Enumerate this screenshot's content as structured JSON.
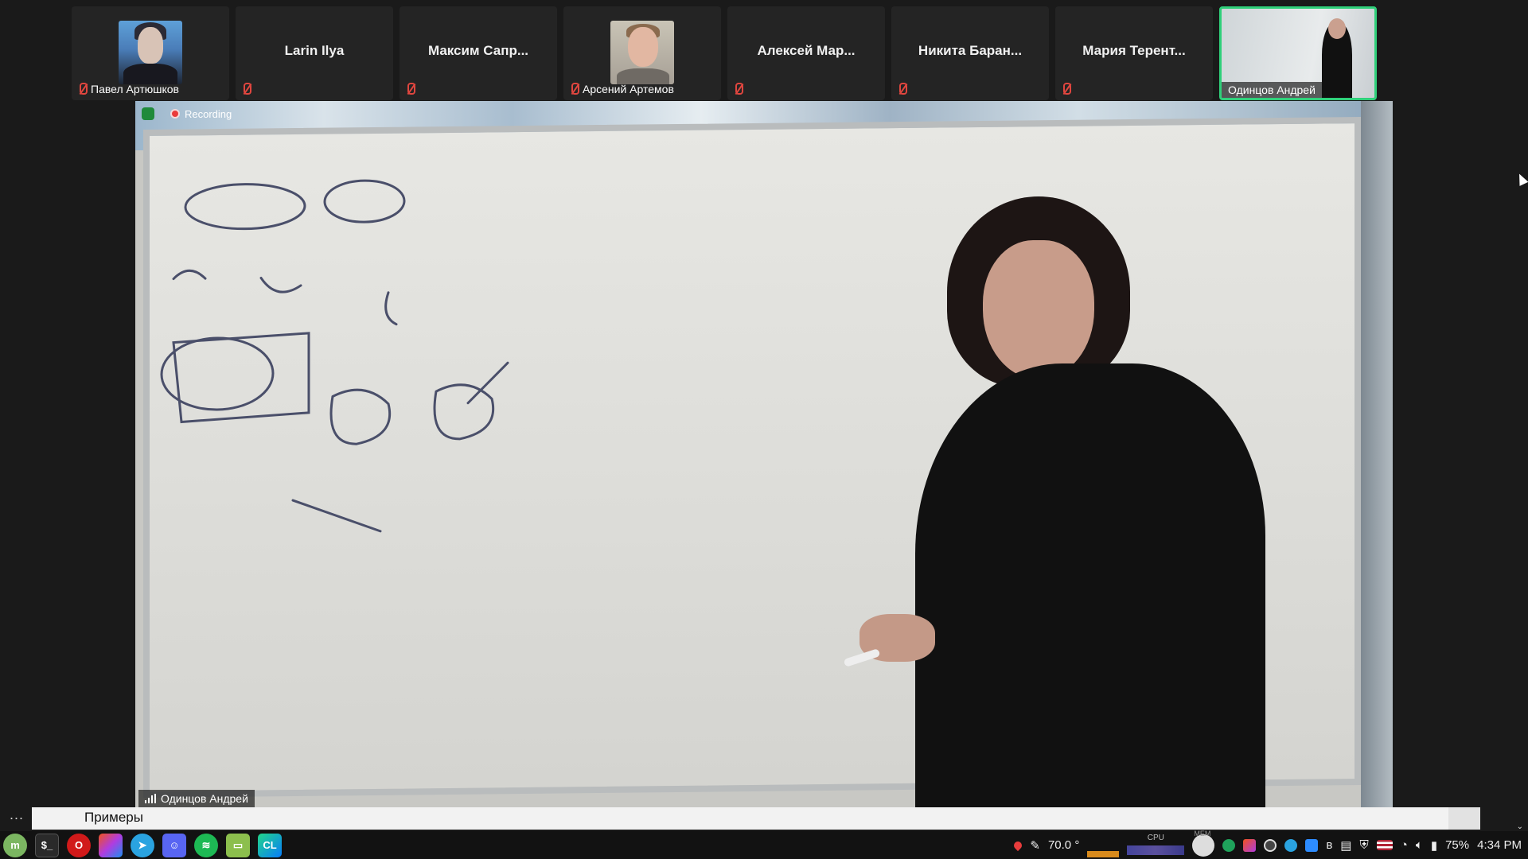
{
  "participants": [
    {
      "name": "Павел Артюшков",
      "has_video": true
    },
    {
      "name": "Larin Ilya",
      "has_video": false
    },
    {
      "name": "Максим Сапр...",
      "has_video": false
    },
    {
      "name": "Арсений Артемов",
      "has_video": true
    },
    {
      "name": "Алексей Мар...",
      "has_video": false
    },
    {
      "name": "Никита Баран...",
      "has_video": false
    },
    {
      "name": "Мария Терент...",
      "has_video": false
    },
    {
      "name": "Одинцов Андрей",
      "has_video": true,
      "active_speaker": true
    }
  ],
  "main_video": {
    "recording_label": "Recording",
    "speaker_name": "Одинцов Андрей"
  },
  "caption": {
    "text": "Примеры"
  },
  "more_label": "...",
  "taskbar": {
    "apps": [
      "mint-menu-icon",
      "terminal-icon",
      "opera-icon",
      "jetbrains-toolbox-icon",
      "telegram-icon",
      "discord-icon",
      "spotify-icon",
      "files-icon",
      "clion-icon"
    ],
    "temperature": "70.0 °",
    "cpu_label": "CPU",
    "mem_label": "MEM",
    "battery": "75%",
    "time": "4:34 PM"
  },
  "colors": {
    "active_border": "#2fd07a",
    "mic_muted": "#e0463f",
    "taskbar": "#121212"
  }
}
